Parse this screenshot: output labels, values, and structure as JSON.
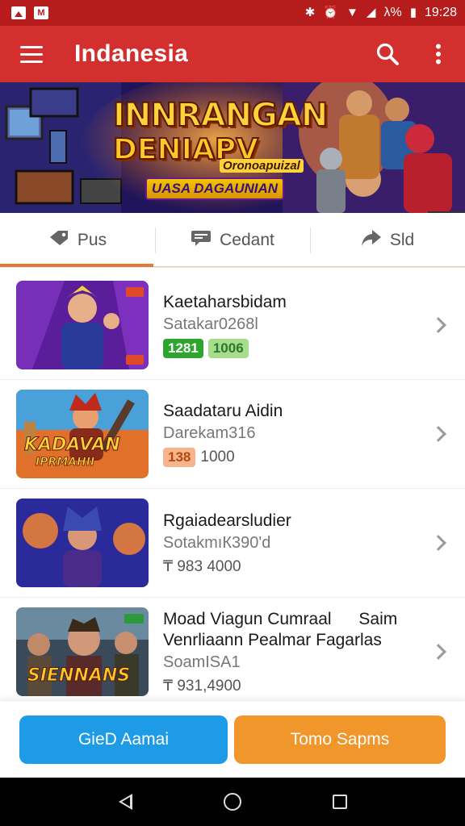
{
  "status_bar": {
    "battery": "λ%",
    "time": "19:28"
  },
  "app_bar": {
    "title": "Indanesia"
  },
  "banner": {
    "headline_1": "INNRANGAN",
    "headline_2": "DENIAPV",
    "tagline": "Oronoapuizal",
    "strip": "UASA DAGAUNIAN"
  },
  "tabs": [
    {
      "label": "Pus",
      "icon": "tag-icon",
      "active": true
    },
    {
      "label": "Cedant",
      "icon": "chat-icon",
      "active": false
    },
    {
      "label": "Sld",
      "icon": "share-icon",
      "active": false
    }
  ],
  "items": [
    {
      "title": "Kaetaharsbidam",
      "title2": "",
      "subtitle": "Satakar0268l",
      "badges": [
        "1281",
        "1006"
      ],
      "price": ""
    },
    {
      "title": "Saadataru Aidin",
      "title2": "",
      "subtitle": "Darekam316",
      "badges": [
        "138"
      ],
      "price": "1000"
    },
    {
      "title": "Rgaiadearsludier",
      "title2": "",
      "subtitle": "SotakmıК390'd",
      "badges": [],
      "price": "₸ 983 4000"
    },
    {
      "title": "Moad Viagun Cumraal",
      "title_right": "Saim",
      "title2": "Venrliaann Pealmar Fagarlas",
      "subtitle": "SoamISA1",
      "badges": [],
      "price": "₸ 931,4900"
    }
  ],
  "thumb_texts": {
    "item2": "KADAVAN",
    "item2b": "IPRMAHII",
    "item4": "SIENNANS"
  },
  "buttons": {
    "left": "GieD Aamai",
    "right": "Tomo Sapms"
  },
  "colors": {
    "app_bar": "#d32f2f",
    "status_bar": "#b71c1c",
    "tab_indicator": "#e07a3a",
    "button_blue": "#1e9be6",
    "button_orange": "#f0962a"
  }
}
